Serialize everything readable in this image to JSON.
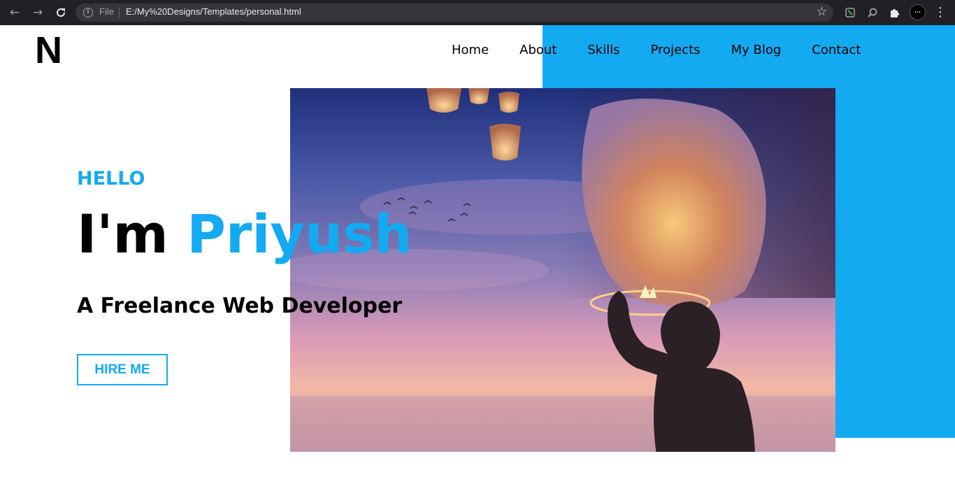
{
  "browser": {
    "scheme_label": "File",
    "url": "E:/My%20Designs/Templates/personal.html",
    "icons": {
      "back": "arrow-left-icon",
      "forward": "arrow-right-icon",
      "reload": "reload-icon",
      "info": "info-icon",
      "bookmark": "star-icon",
      "extensions": "puzzle-icon",
      "menu": "vertical-dots-icon"
    }
  },
  "header": {
    "logo": "N",
    "nav": [
      {
        "label": "Home"
      },
      {
        "label": "About"
      },
      {
        "label": "Skills"
      },
      {
        "label": "Projects"
      },
      {
        "label": "My Blog"
      },
      {
        "label": "Contact"
      }
    ]
  },
  "hero": {
    "greeting": "HELLO",
    "intro": "I'm ",
    "name": "Priyush",
    "subtitle": "A Freelance Web Developer",
    "cta_label": "HIRE ME"
  },
  "colors": {
    "accent": "#13aaf2",
    "text": "#000000",
    "chrome_bg": "#202124",
    "omnibox_bg": "#35363a"
  }
}
